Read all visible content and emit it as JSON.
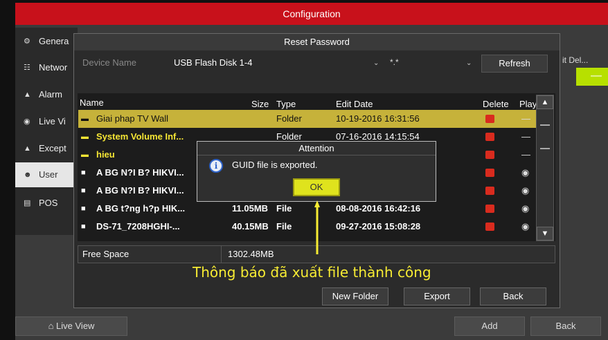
{
  "window": {
    "title": "Configuration"
  },
  "sidebar": {
    "items": [
      {
        "label": "Genera",
        "icon": "gear-icon"
      },
      {
        "label": "Networ",
        "icon": "network-icon"
      },
      {
        "label": "Alarm",
        "icon": "bell-icon"
      },
      {
        "label": "Live Vi",
        "icon": "eye-icon"
      },
      {
        "label": "Except",
        "icon": "warning-icon"
      },
      {
        "label": "User",
        "icon": "users-icon",
        "active": true
      },
      {
        "label": "POS",
        "icon": "pos-icon"
      }
    ]
  },
  "background_table": {
    "header": "it Del...",
    "green_value": "—"
  },
  "bottom_bar": {
    "live_view": "Live View",
    "add": "Add",
    "back": "Back"
  },
  "reset_dialog": {
    "title": "Reset Password",
    "device_label": "Device Name",
    "device_value": "USB Flash Disk 1-4",
    "extension_value": "*.*",
    "refresh_label": "Refresh",
    "columns": {
      "name": "Name",
      "size": "Size",
      "type": "Type",
      "edit_date": "Edit Date",
      "delete": "Delete",
      "play": "Play"
    },
    "rows": [
      {
        "name": "Giai phap TV Wall",
        "size": "",
        "type": "Folder",
        "date": "10-19-2016 16:31:56",
        "kind": "folder",
        "play": "—"
      },
      {
        "name": "System Volume Inf...",
        "size": "",
        "type": "Folder",
        "date": "07-16-2016 14:15:54",
        "kind": "folder",
        "play": "—"
      },
      {
        "name": "hieu",
        "size": "",
        "type": "",
        "date": "",
        "kind": "folder",
        "play": "—"
      },
      {
        "name": "A BG N?I B? HIKVI...",
        "size": "",
        "type": "",
        "date": "",
        "kind": "file",
        "play": "◉"
      },
      {
        "name": "A BG N?I B? HIKVI...",
        "size": "",
        "type": "",
        "date": "",
        "kind": "file",
        "play": "◉"
      },
      {
        "name": "A BG t?ng h?p HIK...",
        "size": "11.05MB",
        "type": "File",
        "date": "08-08-2016 16:42:16",
        "kind": "file",
        "play": "◉"
      },
      {
        "name": "DS-71_7208HGHI-...",
        "size": "40.15MB",
        "type": "File",
        "date": "09-27-2016 15:08:28",
        "kind": "file",
        "play": "◉"
      }
    ],
    "free_space_label": "Free Space",
    "free_space_value": "1302.48MB",
    "buttons": {
      "new_folder": "New Folder",
      "export": "Export",
      "back": "Back"
    }
  },
  "attention": {
    "title": "Attention",
    "message": "GUID file is exported.",
    "ok_label": "OK"
  },
  "annotation": {
    "text": "Thông báo đã xuất file thành công",
    "color": "#f7ec33"
  },
  "colors": {
    "title_bar": "#c8111b",
    "selected_row": "#c6b23a",
    "folder_text": "#f6e634",
    "ok_button": "#dfe31d",
    "delete_icon": "#d92b1e"
  }
}
